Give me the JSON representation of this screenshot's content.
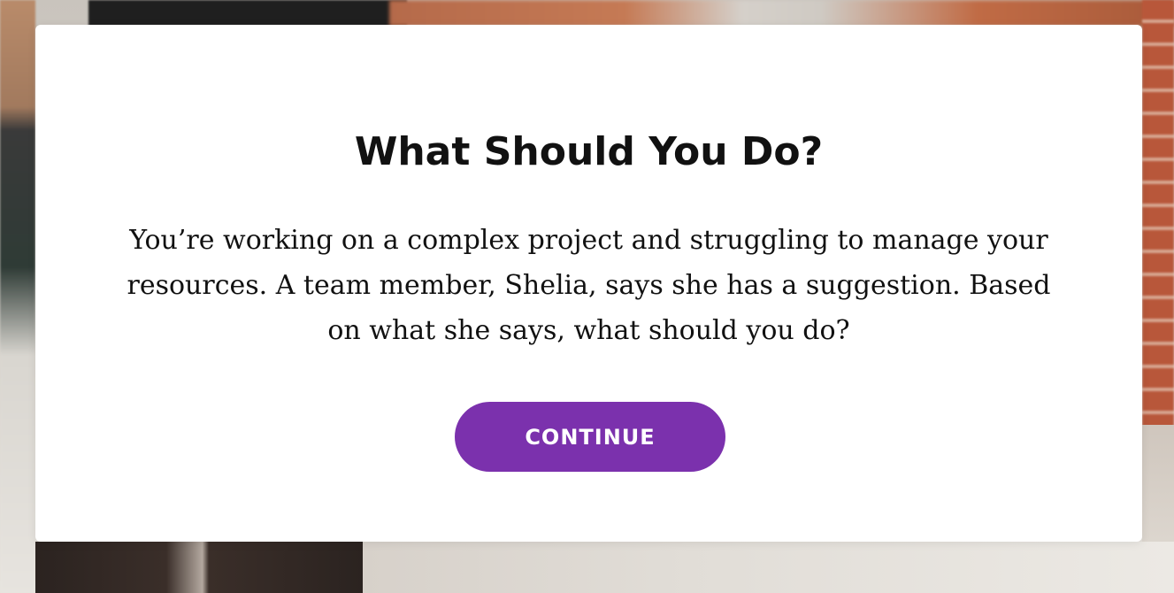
{
  "modal": {
    "title": "What Should You Do?",
    "body": "You’re working on a complex project and struggling to manage your resources. A team member, Shelia, says she has a suggestion. Based on what she says, what should you do?",
    "continue_label": "CONTINUE"
  },
  "colors": {
    "button_bg": "#7b31ad",
    "button_text": "#ffffff",
    "modal_bg": "#ffffff",
    "text": "#111111"
  }
}
